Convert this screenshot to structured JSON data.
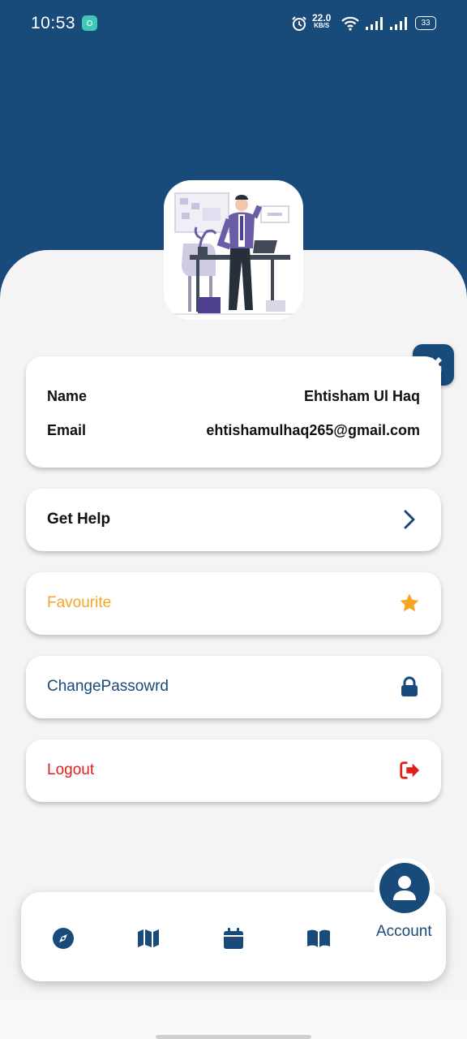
{
  "status_bar": {
    "time": "10:53",
    "net_speed": "22.0",
    "net_unit": "KB/S",
    "battery": "33"
  },
  "profile": {
    "name_label": "Name",
    "name_value": "Ehtisham Ul Haq",
    "email_label": "Email",
    "email_value": "ehtishamulhaq265@gmail.com"
  },
  "menu": [
    {
      "label": "Get Help",
      "icon": "chevron-right-icon",
      "color": "#111111"
    },
    {
      "label": "Favourite",
      "icon": "star-icon",
      "color": "#f5a623"
    },
    {
      "label": "ChangePassowrd",
      "icon": "lock-icon",
      "color": "#184a7a"
    },
    {
      "label": "Logout",
      "icon": "logout-icon",
      "color": "#e01e1e"
    }
  ],
  "bottom_nav": {
    "items": [
      "compass-icon",
      "map-icon",
      "calendar-icon",
      "book-icon"
    ],
    "active_label": "Account"
  },
  "colors": {
    "primary": "#184a7a",
    "favourite": "#f5a623",
    "logout": "#e01e1e"
  }
}
